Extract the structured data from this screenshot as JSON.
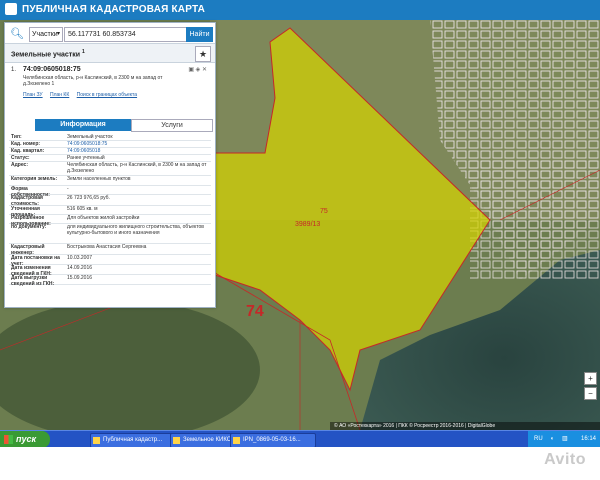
{
  "app": {
    "title": "ПУБЛИЧНАЯ КАДАСТРОВАЯ КАРТА"
  },
  "search": {
    "type_value": "Участки",
    "query_value": "56.117731 60.853734",
    "find_label": "Найти"
  },
  "panel": {
    "section_title": "Земельные участки",
    "section_count": "1",
    "item": {
      "index": "1.",
      "number": "74:09:0605018:75",
      "address": "Челябинская область, р-н Каслинский, в 2300 м на запад от д.Зюзелено 1",
      "links": [
        "План ЗУ",
        "План КК",
        "Поиск в границах объекта"
      ]
    },
    "tabs": [
      "Информация",
      "Услуги"
    ],
    "rows": [
      {
        "k": "Тип:",
        "v": "Земельный участок"
      },
      {
        "k": "Кад. номер:",
        "v": "74:09:0605018:75"
      },
      {
        "k": "Кад. квартал:",
        "v": "74:09:0605018"
      },
      {
        "k": "Статус:",
        "v": "Ранее учтенный"
      },
      {
        "k": "Адрес:",
        "v": "Челябинская область, р-н Каслинский, в 2300 м на запад от д.Зюзелено"
      },
      {
        "k": "Категория земель:",
        "v": "Земли населенных пунктов"
      },
      {
        "k": "Форма собственности:",
        "v": "-"
      },
      {
        "k": "Кадастровая стоимость:",
        "v": "26 723 976,65 руб."
      },
      {
        "k": "Уточненная площадь:",
        "v": "516 605 кв. м"
      },
      {
        "k": "Разрешенное использование:",
        "v": "Для объектов жилой застройки"
      },
      {
        "k": "по документу:",
        "v": "для индивидуального жилищного строительства, объектов культурно-бытового и иного назначения"
      },
      {
        "k": "Кадастровый инженер:",
        "v": "Бострыкова Анастасия Сергеевна"
      },
      {
        "k": "Дата постановки на учет:",
        "v": "10.03.2007"
      },
      {
        "k": "Дата изменения сведений в ГКН:",
        "v": "14.09.2016"
      },
      {
        "k": "Дата выгрузки сведений из ГКН:",
        "v": "15.09.2016"
      }
    ]
  },
  "map": {
    "labels": [
      "74",
      "75",
      "3989/13"
    ],
    "parcel_color": "#d4d200",
    "boundary_color": "#c62828",
    "attribution": "© АО «Ростехкарта» 2016 | ПКК © Росреестр 2016-2016 | DigitalGlobe"
  },
  "zoom": {
    "in": "+",
    "out": "−"
  },
  "taskbar": {
    "start_label": "пуск",
    "tasks": [
      "Публичная кадастр...",
      "Земельное КИКС",
      "IPN_0869-05-03-16..."
    ],
    "tray_lang": "RU",
    "clock": "16:14"
  },
  "watermark": "Avito"
}
